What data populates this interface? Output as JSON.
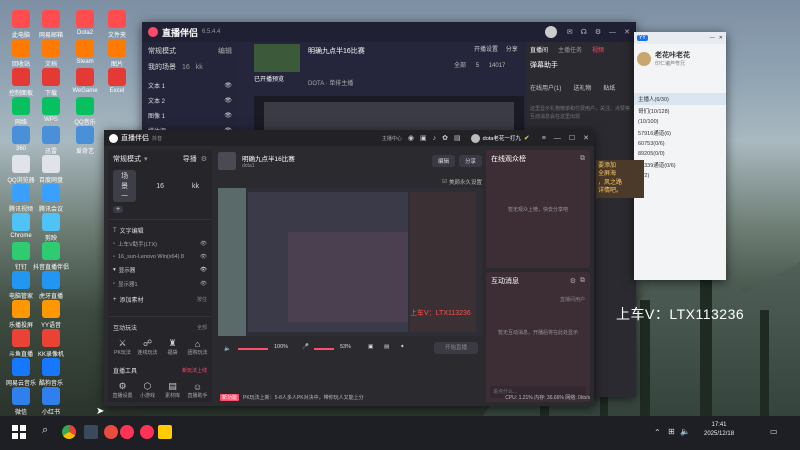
{
  "desktop": {
    "icons_col1": [
      "此电脑",
      "回收站",
      "控制面板",
      "网络",
      "360",
      "QQ浏览器",
      "腾讯视频",
      "Chrome",
      "钉钉",
      "电脑管家",
      "乐播投屏",
      "斗鱼直播",
      "网易云音乐",
      "微信"
    ],
    "icons_col2": [
      "网易邮箱",
      "文档",
      "下载",
      "WPS",
      "迅雷",
      "百度网盘",
      "腾讯会议",
      "剪映",
      "抖音直播伴侣",
      "虎牙直播",
      "YY语音",
      "KK录像机",
      "酷狗音乐",
      "小红书"
    ],
    "icons_col3": [
      "Dota2",
      "Steam",
      "WeGame",
      "QQ音乐",
      "爱奇艺"
    ],
    "icons_col4": [
      "文件夹",
      "图片",
      "Excel"
    ]
  },
  "back_obs": {
    "title": "直播伴侣",
    "version": "6.5.4.4",
    "mode": "常规模式",
    "edit": "编辑",
    "scene_label": "我的场景",
    "scene_tabs": [
      "1",
      "16",
      "kk"
    ],
    "sources": [
      "文本 1",
      "文本 2",
      "图像 1",
      "媒体源",
      "窗口采集"
    ],
    "stream_title": "明确九点半16比赛",
    "stream_sub": "已开播预览",
    "game_tag": "DOTA · 单排主播",
    "top_actions": [
      "开播设置",
      "分享"
    ],
    "side_tabs": [
      "直播间",
      "主播任务",
      "视频"
    ],
    "assistant": "弹幕助手",
    "right_tabs": [
      "在线用户(1)",
      "送礼物",
      "贴纸"
    ],
    "info_text": "这里显示礼物榜单和付费用户，关注、点赞等互动消息会在这里出现",
    "counts": [
      "全部",
      "5",
      "14017"
    ]
  },
  "yy": {
    "header": "YY",
    "user": "老花咔老花",
    "sub": "印仁诸芦粤兄",
    "list": [
      "主播人(6/30)",
      "哥们(10/128)",
      "(10/100)",
      "57916通道(6)",
      "60753(0/6)",
      "89205(0/0)",
      "12339通道(0/6)",
      "(2/2)"
    ]
  },
  "popup": {
    "lines": [
      "要添加",
      "全屏海",
      "，风之路",
      "详情吧。"
    ]
  },
  "watermark": "上车V：LTX113236",
  "front": {
    "app": "直播伴侣",
    "app_sub": "抖音",
    "mode": "常规模式",
    "import_label": "导播",
    "scene_name": "场景一",
    "scene_tabs": [
      "16",
      "kk"
    ],
    "sources_header": "文字编辑",
    "sources": [
      "上车V助手(LTX)",
      "16_sun-Lenovo Win(x64) 8",
      "显示器",
      "显示器1"
    ],
    "add_material": "添加素材",
    "add_hint": "按住",
    "interact_title": "互动玩法",
    "interact_all": "全部",
    "interact_items": [
      "PK玩法",
      "连线玩法",
      "福袋",
      "团购玩法"
    ],
    "tools_title": "直播工具",
    "tools_more": "新玩法上线",
    "tools_items": [
      "直播设置",
      "小游戏",
      "素材库",
      "直播助手"
    ],
    "stream_title": "明确九点半16比赛",
    "stream_sub": "dota1",
    "edit_label": "编辑",
    "share_label": "分享",
    "preview_check": "美颜永久设置",
    "user_name": "dota老花一打九",
    "online_title": "在线观众榜",
    "online_empty": "暂无观众上榜，快去分享吧",
    "msg_title": "互动消息",
    "msg_hint": "直播间用户",
    "msg_empty": "暂无互动消息，开播后将在此处显示",
    "chat_placeholder": "说点什么...",
    "volume1": "100%",
    "volume2": "53%",
    "start_button": "开始直播",
    "status_tag": "新功能",
    "status_text": "PK玩法上新：5-8人多人PK对决中，带你玩人又能上分",
    "stats": "CPU: 1.21%   内存: 36.66%   网络: 0kb/s",
    "top_labels": [
      "主播中心",
      "推流中"
    ]
  },
  "inner_watermark": "上车V：LTX113236",
  "taskbar": {
    "time": "17:41",
    "date": "2025/12/18",
    "search_icon": "search-icon"
  }
}
